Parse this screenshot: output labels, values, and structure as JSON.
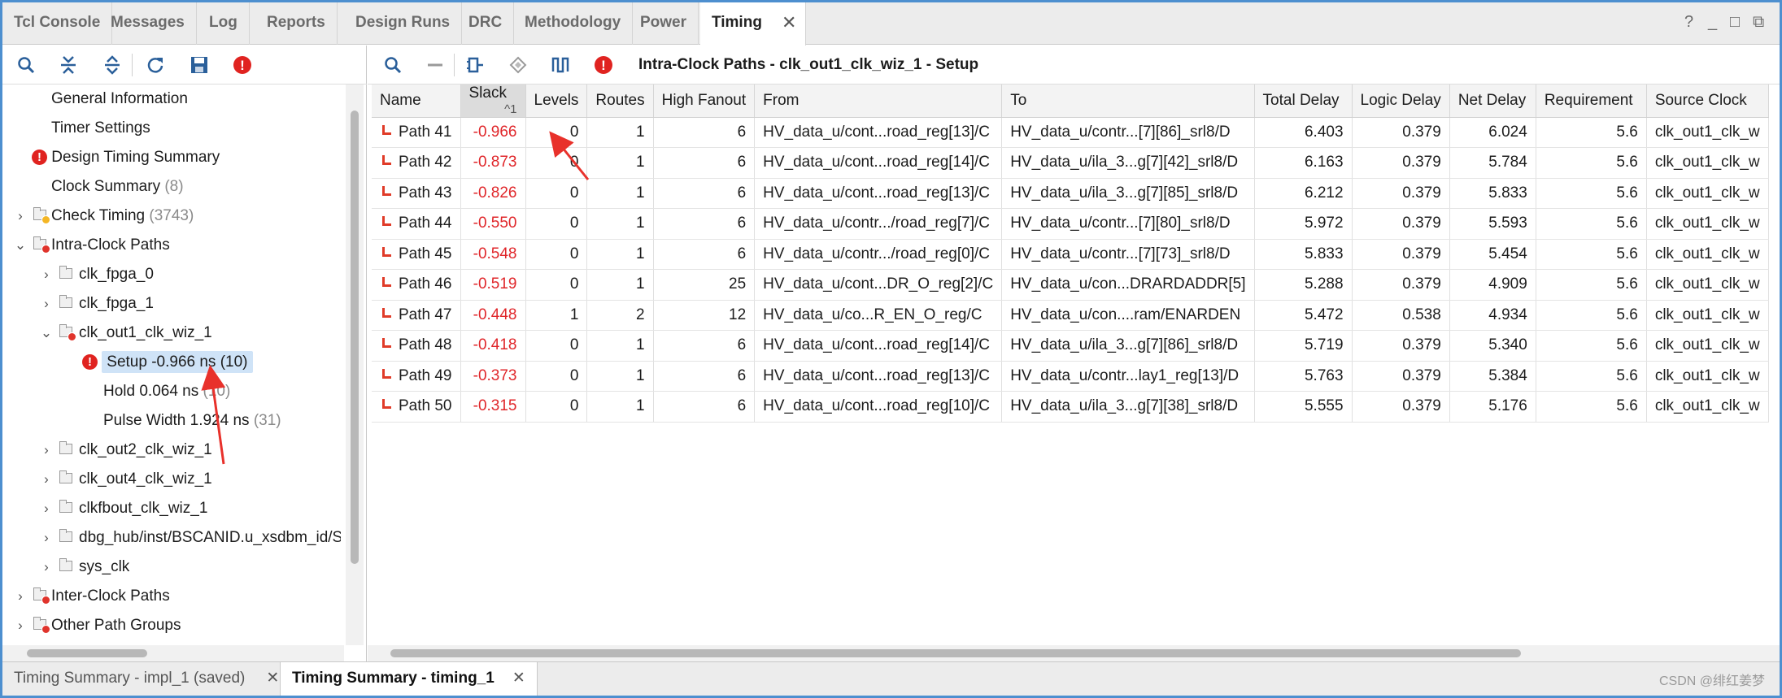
{
  "top_tabs": [
    {
      "label": "Tcl Console"
    },
    {
      "label": "Messages"
    },
    {
      "label": "Log"
    },
    {
      "label": "Reports"
    },
    {
      "label": "Design Runs"
    },
    {
      "label": "DRC"
    },
    {
      "label": "Methodology"
    },
    {
      "label": "Power"
    },
    {
      "label": "Timing",
      "active": true
    }
  ],
  "window_controls": {
    "help": "?",
    "minimize": "_",
    "restore": "□",
    "float": "⧉"
  },
  "tree": {
    "items": [
      {
        "label": "General Information"
      },
      {
        "label": "Timer Settings"
      },
      {
        "label": "Design Timing Summary"
      },
      {
        "label": "Clock Summary",
        "count": "(8)"
      },
      {
        "label": "Check Timing",
        "count": "(3743)"
      },
      {
        "label": "Intra-Clock Paths"
      },
      {
        "label": "clk_fpga_0"
      },
      {
        "label": "clk_fpga_1"
      },
      {
        "label": "clk_out1_clk_wiz_1"
      },
      {
        "label": "Setup -0.966 ns (10)"
      },
      {
        "label": "Hold 0.064 ns",
        "count": "(10)"
      },
      {
        "label": "Pulse Width 1.924 ns",
        "count": "(31)"
      },
      {
        "label": "clk_out2_clk_wiz_1"
      },
      {
        "label": "clk_out4_clk_wiz_1"
      },
      {
        "label": "clkfbout_clk_wiz_1"
      },
      {
        "label": "dbg_hub/inst/BSCANID.u_xsdbm_id/SW"
      },
      {
        "label": "sys_clk"
      },
      {
        "label": "Inter-Clock Paths"
      },
      {
        "label": "Other Path Groups"
      }
    ]
  },
  "right_panel": {
    "title": "Intra-Clock Paths - clk_out1_clk_wiz_1 - Setup"
  },
  "table": {
    "columns": [
      "Name",
      "Slack",
      "Levels",
      "Routes",
      "High Fanout",
      "From",
      "To",
      "Total Delay",
      "Logic Delay",
      "Net Delay",
      "Requirement",
      "Source Clock"
    ],
    "sort_indicator": "^1",
    "rows": [
      [
        "Path 41",
        "-0.966",
        "0",
        "1",
        "6",
        "HV_data_u/cont...road_reg[13]/C",
        "HV_data_u/contr...[7][86]_srl8/D",
        "6.403",
        "0.379",
        "6.024",
        "5.6",
        "clk_out1_clk_w"
      ],
      [
        "Path 42",
        "-0.873",
        "0",
        "1",
        "6",
        "HV_data_u/cont...road_reg[14]/C",
        "HV_data_u/ila_3...g[7][42]_srl8/D",
        "6.163",
        "0.379",
        "5.784",
        "5.6",
        "clk_out1_clk_w"
      ],
      [
        "Path 43",
        "-0.826",
        "0",
        "1",
        "6",
        "HV_data_u/cont...road_reg[13]/C",
        "HV_data_u/ila_3...g[7][85]_srl8/D",
        "6.212",
        "0.379",
        "5.833",
        "5.6",
        "clk_out1_clk_w"
      ],
      [
        "Path 44",
        "-0.550",
        "0",
        "1",
        "6",
        "HV_data_u/contr.../road_reg[7]/C",
        "HV_data_u/contr...[7][80]_srl8/D",
        "5.972",
        "0.379",
        "5.593",
        "5.6",
        "clk_out1_clk_w"
      ],
      [
        "Path 45",
        "-0.548",
        "0",
        "1",
        "6",
        "HV_data_u/contr.../road_reg[0]/C",
        "HV_data_u/contr...[7][73]_srl8/D",
        "5.833",
        "0.379",
        "5.454",
        "5.6",
        "clk_out1_clk_w"
      ],
      [
        "Path 46",
        "-0.519",
        "0",
        "1",
        "25",
        "HV_data_u/cont...DR_O_reg[2]/C",
        "HV_data_u/con...DRARDADDR[5]",
        "5.288",
        "0.379",
        "4.909",
        "5.6",
        "clk_out1_clk_w"
      ],
      [
        "Path 47",
        "-0.448",
        "1",
        "2",
        "12",
        "HV_data_u/co...R_EN_O_reg/C",
        "HV_data_u/con....ram/ENARDEN",
        "5.472",
        "0.538",
        "4.934",
        "5.6",
        "clk_out1_clk_w"
      ],
      [
        "Path 48",
        "-0.418",
        "0",
        "1",
        "6",
        "HV_data_u/cont...road_reg[14]/C",
        "HV_data_u/ila_3...g[7][86]_srl8/D",
        "5.719",
        "0.379",
        "5.340",
        "5.6",
        "clk_out1_clk_w"
      ],
      [
        "Path 49",
        "-0.373",
        "0",
        "1",
        "6",
        "HV_data_u/cont...road_reg[13]/C",
        "HV_data_u/contr...lay1_reg[13]/D",
        "5.763",
        "0.379",
        "5.384",
        "5.6",
        "clk_out1_clk_w"
      ],
      [
        "Path 50",
        "-0.315",
        "0",
        "1",
        "6",
        "HV_data_u/cont...road_reg[10]/C",
        "HV_data_u/ila_3...g[7][38]_srl8/D",
        "5.555",
        "0.379",
        "5.176",
        "5.6",
        "clk_out1_clk_w"
      ]
    ]
  },
  "bottom_tabs": [
    {
      "label": "Timing Summary - impl_1 (saved)"
    },
    {
      "label": "Timing Summary - timing_1",
      "active": true
    }
  ],
  "watermark": "CSDN @绯红姜梦",
  "colors": {
    "accent_border": "#4d8fcf",
    "negative_slack": "#e0262a",
    "error_icon": "#e02320",
    "arrow": "#e8312b"
  }
}
